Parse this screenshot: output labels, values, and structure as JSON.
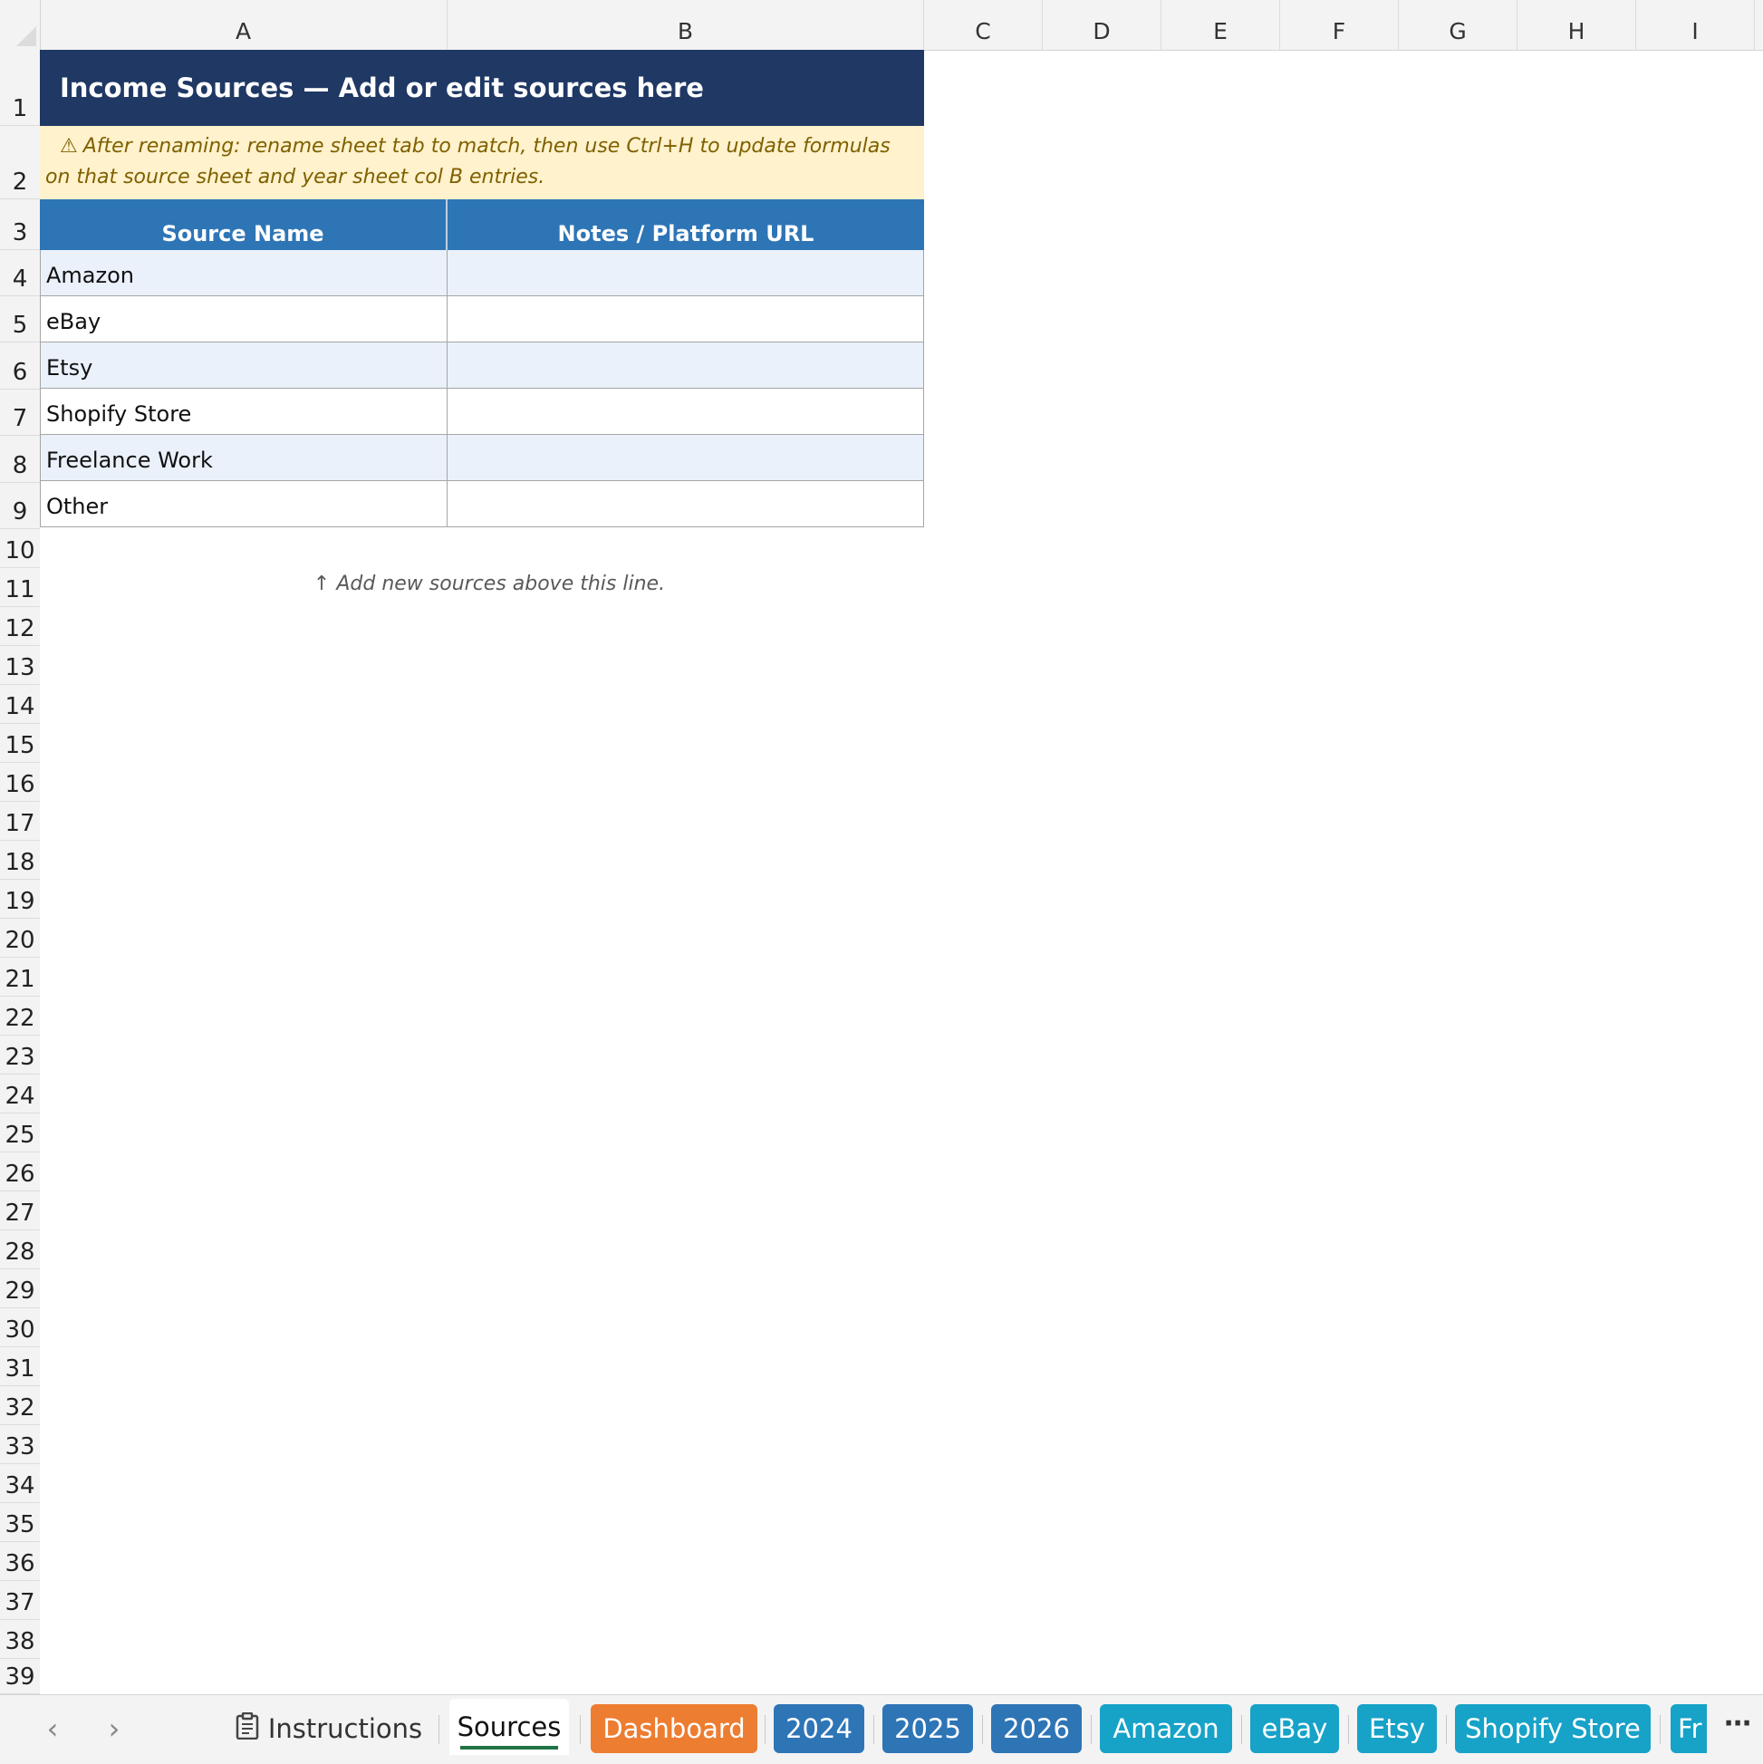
{
  "columns": [
    "A",
    "B",
    "C",
    "D",
    "E",
    "F",
    "G",
    "H",
    "I"
  ],
  "rows": [
    "1",
    "2",
    "3",
    "4",
    "5",
    "6",
    "7",
    "8",
    "9",
    "10",
    "11",
    "12",
    "13",
    "14",
    "15",
    "16",
    "17",
    "18",
    "19",
    "20",
    "21",
    "22",
    "23",
    "24",
    "25",
    "26",
    "27",
    "28",
    "29",
    "30",
    "31",
    "32",
    "33",
    "34",
    "35",
    "36",
    "37",
    "38",
    "39"
  ],
  "sheet": {
    "title": "Income Sources — Add or edit sources here",
    "warning_icon": "⚠",
    "warning": "After renaming: rename sheet tab to match, then use Ctrl+H to update formulas on that source sheet and year sheet col B entries.",
    "headers": {
      "source_name": "Source Name",
      "notes": "Notes / Platform URL"
    },
    "sources": [
      {
        "name": "Amazon",
        "notes": ""
      },
      {
        "name": "eBay",
        "notes": ""
      },
      {
        "name": "Etsy",
        "notes": ""
      },
      {
        "name": "Shopify Store",
        "notes": ""
      },
      {
        "name": "Freelance Work",
        "notes": ""
      },
      {
        "name": "Other",
        "notes": ""
      }
    ],
    "hint_icon": "↑",
    "hint": "Add new sources above this line."
  },
  "tabs": {
    "prev": "‹",
    "next": "›",
    "items": [
      {
        "label": "Instructions",
        "style": "plain",
        "icon": "clipboard-icon"
      },
      {
        "label": "Sources",
        "style": "active"
      },
      {
        "label": "Dashboard",
        "style": "orange"
      },
      {
        "label": "2024",
        "style": "blue"
      },
      {
        "label": "2025",
        "style": "blue"
      },
      {
        "label": "2026",
        "style": "blue"
      },
      {
        "label": "Amazon",
        "style": "teal"
      },
      {
        "label": "eBay",
        "style": "teal"
      },
      {
        "label": "Etsy",
        "style": "teal"
      },
      {
        "label": "Shopify Store",
        "style": "teal"
      },
      {
        "label": "Fr",
        "style": "teal"
      }
    ],
    "more": "⋯"
  },
  "colors": {
    "title_bg": "#1f3864",
    "warning_bg": "#fff2cc",
    "header_bg": "#2e75b6",
    "alt_row_bg": "#eaf1fb",
    "tab_orange": "#ed7d31",
    "tab_blue": "#2e75b6",
    "tab_teal": "#17a2c8"
  }
}
